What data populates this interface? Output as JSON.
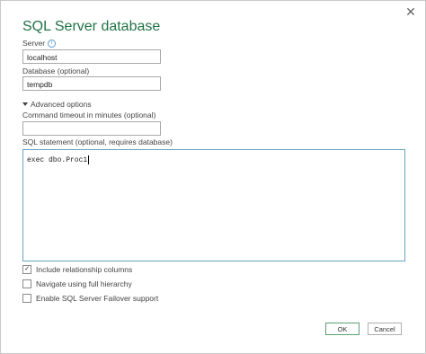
{
  "dialog": {
    "title": "SQL Server database",
    "close_glyph": "✕"
  },
  "server": {
    "label": "Server",
    "info_glyph": "i",
    "value": "localhost"
  },
  "database": {
    "label": "Database (optional)",
    "value": "tempdb"
  },
  "advanced": {
    "label": "Advanced options"
  },
  "timeout": {
    "label": "Command timeout in minutes (optional)",
    "value": ""
  },
  "sql": {
    "label": "SQL statement (optional, requires database)",
    "value": "exec dbo.Proc1"
  },
  "options": [
    {
      "label": "Include relationship columns",
      "checked": true
    },
    {
      "label": "Navigate using full hierarchy",
      "checked": false
    },
    {
      "label": "Enable SQL Server Failover support",
      "checked": false
    }
  ],
  "buttons": {
    "ok": "OK",
    "cancel": "Cancel"
  }
}
